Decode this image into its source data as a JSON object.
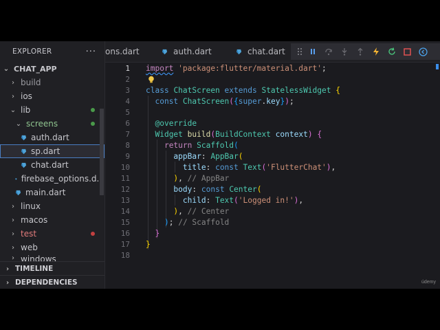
{
  "explorer": {
    "title": "EXPLORER",
    "more": "···",
    "project": "CHAT_APP",
    "items": [
      {
        "label": "build",
        "chev": "›",
        "color": "#9a9aa0"
      },
      {
        "label": "ios",
        "chev": "›",
        "color": "#c7c7cc"
      },
      {
        "label": "lib",
        "chev": "⌄",
        "color": "#c7c7cc"
      },
      {
        "label": "screens",
        "chev": "⌄",
        "color": "#8fc48f"
      },
      {
        "label": "auth.dart",
        "color": "#c7c7cc"
      },
      {
        "label": "sp.dart",
        "color": "#c7c7cc"
      },
      {
        "label": "chat.dart",
        "color": "#c7c7cc"
      },
      {
        "label": "firebase_options.d...",
        "color": "#c7c7cc"
      },
      {
        "label": "main.dart",
        "color": "#c7c7cc"
      },
      {
        "label": "linux",
        "chev": "›",
        "color": "#c7c7cc"
      },
      {
        "label": "macos",
        "chev": "›",
        "color": "#c7c7cc"
      },
      {
        "label": "test",
        "chev": "›",
        "color": "#e07a7a"
      },
      {
        "label": "web",
        "chev": "›",
        "color": "#c7c7cc"
      },
      {
        "label": "windows",
        "chev": "›",
        "color": "#c7c7cc"
      }
    ],
    "timeline": "TIMELINE",
    "dependencies": "DEPENDENCIES"
  },
  "tabs": [
    {
      "label": "ons.dart"
    },
    {
      "label": "auth.dart"
    },
    {
      "label": "chat.dart"
    }
  ],
  "debug_icons": [
    "drag-handle-icon",
    "pause-icon",
    "step-over-icon",
    "step-into-icon",
    "step-out-icon",
    "hot-reload-icon",
    "restart-icon",
    "stop-icon",
    "devtools-icon"
  ],
  "editor": {
    "line_numbers": [
      "1",
      "2",
      "3",
      "4",
      "5",
      "6",
      "7",
      "8",
      "9",
      "10",
      "11",
      "12",
      "13",
      "14",
      "15",
      "16",
      "17",
      "18"
    ],
    "active_line": "1"
  },
  "code": {
    "l1": {
      "kw": "import",
      "str": "'package:flutter/material.dart'",
      "end": ";"
    },
    "l3": {
      "kw1": "class",
      "name": "ChatScreen",
      "kw2": "extends",
      "base": "StatelessWidget",
      "br": "{"
    },
    "l4": {
      "kw": "const",
      "name": "ChatScreen",
      "br1": "(",
      "br2": "{",
      "sup": "super",
      "dot": ".",
      "key": "key",
      "br3": "}",
      "br4": ")",
      "end": ";"
    },
    "l6": {
      "ann": "@override"
    },
    "l7": {
      "ty": "Widget",
      "fn": "build",
      "br1": "(",
      "ty2": "BuildContext",
      "p": "context",
      "br2": ")",
      "br3": "{"
    },
    "l8": {
      "kw": "return",
      "fn": "Scaffold",
      "br": "("
    },
    "l9": {
      "p": "appBar",
      "c": ":",
      "fn": "AppBar",
      "br": "("
    },
    "l10": {
      "p": "title",
      "c": ":",
      "kw": "const",
      "fn": "Text",
      "br1": "(",
      "str": "'FlutterChat'",
      "br2": ")",
      "end": ","
    },
    "l11": {
      "br": ")",
      "end": ",",
      "cm": "// AppBar"
    },
    "l12": {
      "p": "body",
      "c": ":",
      "kw": "const",
      "fn": "Center",
      "br": "("
    },
    "l13": {
      "p": "child",
      "c": ":",
      "fn": "Text",
      "br1": "(",
      "str": "'Logged in!'",
      "br2": ")",
      "end": ","
    },
    "l14": {
      "br": ")",
      "end": ",",
      "cm": "// Center"
    },
    "l15": {
      "br": ")",
      "end": ";",
      "cm": "// Scaffold"
    },
    "l16": {
      "br": "}"
    },
    "l17": {
      "br": "}"
    }
  },
  "watermark": "údemy",
  "colors": {
    "accent": "#3b8eea",
    "modified_dot": "#4a9a4a",
    "error_dot": "#c24040",
    "dart_icon": "#4fa3d8"
  }
}
